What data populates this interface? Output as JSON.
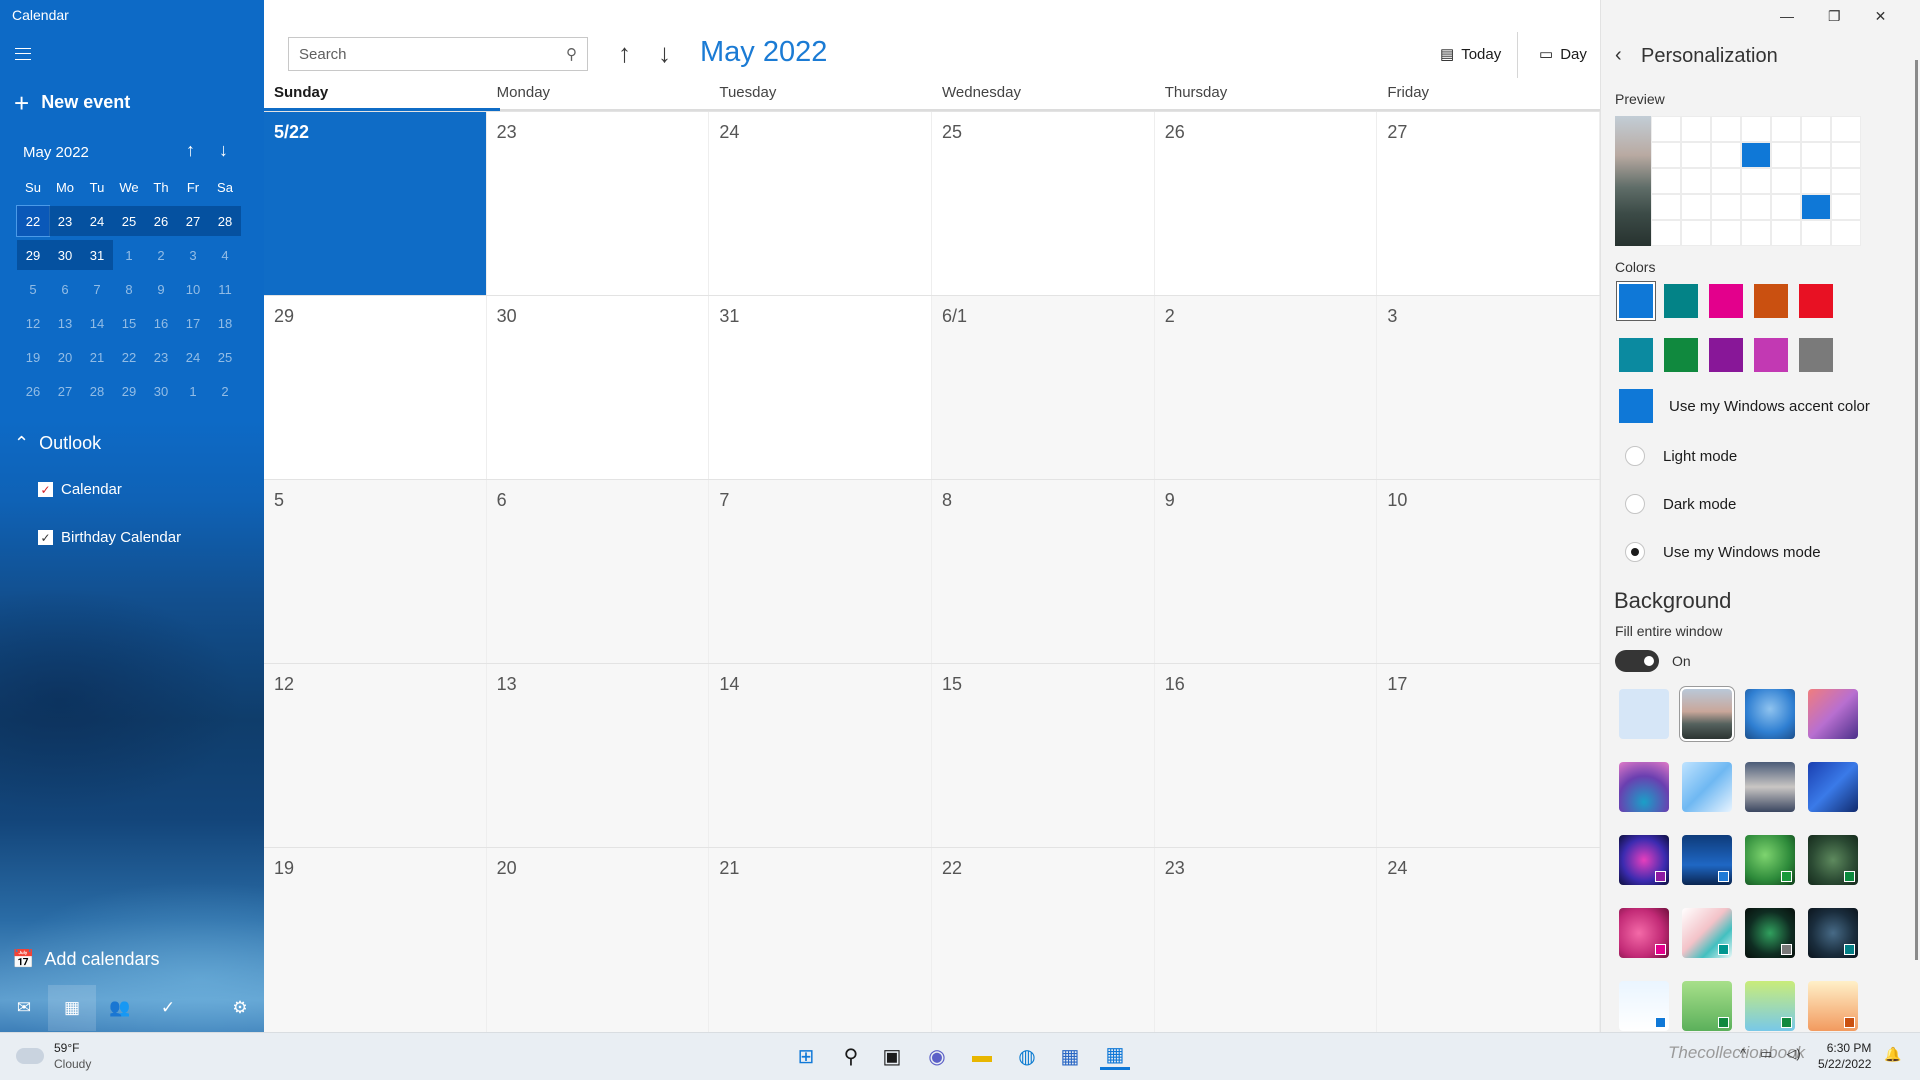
{
  "app": {
    "title": "Calendar"
  },
  "sidebar": {
    "new_event": "New event",
    "mini_calendar": {
      "title": "May 2022",
      "weekdays": [
        "Su",
        "Mo",
        "Tu",
        "We",
        "Th",
        "Fr",
        "Sa"
      ],
      "weeks": [
        [
          "22",
          "23",
          "24",
          "25",
          "26",
          "27",
          "28"
        ],
        [
          "29",
          "30",
          "31",
          "1",
          "2",
          "3",
          "4"
        ],
        [
          "5",
          "6",
          "7",
          "8",
          "9",
          "10",
          "11"
        ],
        [
          "12",
          "13",
          "14",
          "15",
          "16",
          "17",
          "18"
        ],
        [
          "19",
          "20",
          "21",
          "22",
          "23",
          "24",
          "25"
        ],
        [
          "26",
          "27",
          "28",
          "29",
          "30",
          "1",
          "2"
        ]
      ]
    },
    "account": "Outlook",
    "calendars": [
      {
        "label": "Calendar",
        "checked": true,
        "color": "#d42027"
      },
      {
        "label": "Birthday Calendar",
        "checked": true,
        "color": "#ffffff"
      }
    ],
    "add_calendars": "Add calendars",
    "bottom_nav": [
      "mail-icon",
      "calendar-icon",
      "people-icon",
      "todo-icon",
      "settings-icon"
    ]
  },
  "toolbar": {
    "search_placeholder": "Search",
    "month_title": "May 2022",
    "today_label": "Today",
    "day_label": "Day"
  },
  "month_view": {
    "weekday_headers": [
      "Sunday",
      "Monday",
      "Tuesday",
      "Wednesday",
      "Thursday",
      "Friday"
    ],
    "weeks": [
      [
        "5/22",
        "23",
        "24",
        "25",
        "26",
        "27"
      ],
      [
        "29",
        "30",
        "31",
        "6/1",
        "2",
        "3"
      ],
      [
        "5",
        "6",
        "7",
        "8",
        "9",
        "10"
      ],
      [
        "12",
        "13",
        "14",
        "15",
        "16",
        "17"
      ],
      [
        "19",
        "20",
        "21",
        "22",
        "23",
        "24"
      ]
    ]
  },
  "personalization": {
    "title": "Personalization",
    "preview_label": "Preview",
    "colors_label": "Colors",
    "colors": [
      "#0f78d7",
      "#038387",
      "#e3008c",
      "#ca5010",
      "#e81123",
      "#0b8aa0",
      "#10893e",
      "#881798",
      "#c239b3",
      "#7a7a7a"
    ],
    "accent_color": "#0f78d7",
    "accent_label": "Use my Windows accent color",
    "modes": [
      {
        "label": "Light mode",
        "selected": false
      },
      {
        "label": "Dark mode",
        "selected": false
      },
      {
        "label": "Use my Windows mode",
        "selected": true
      }
    ],
    "background_title": "Background",
    "fill_label": "Fill entire window",
    "fill_state": "On"
  },
  "taskbar": {
    "temperature": "59°F",
    "condition": "Cloudy",
    "time": "6:30 PM",
    "date": "5/22/2022"
  },
  "watermark": "Theсollectionbook"
}
